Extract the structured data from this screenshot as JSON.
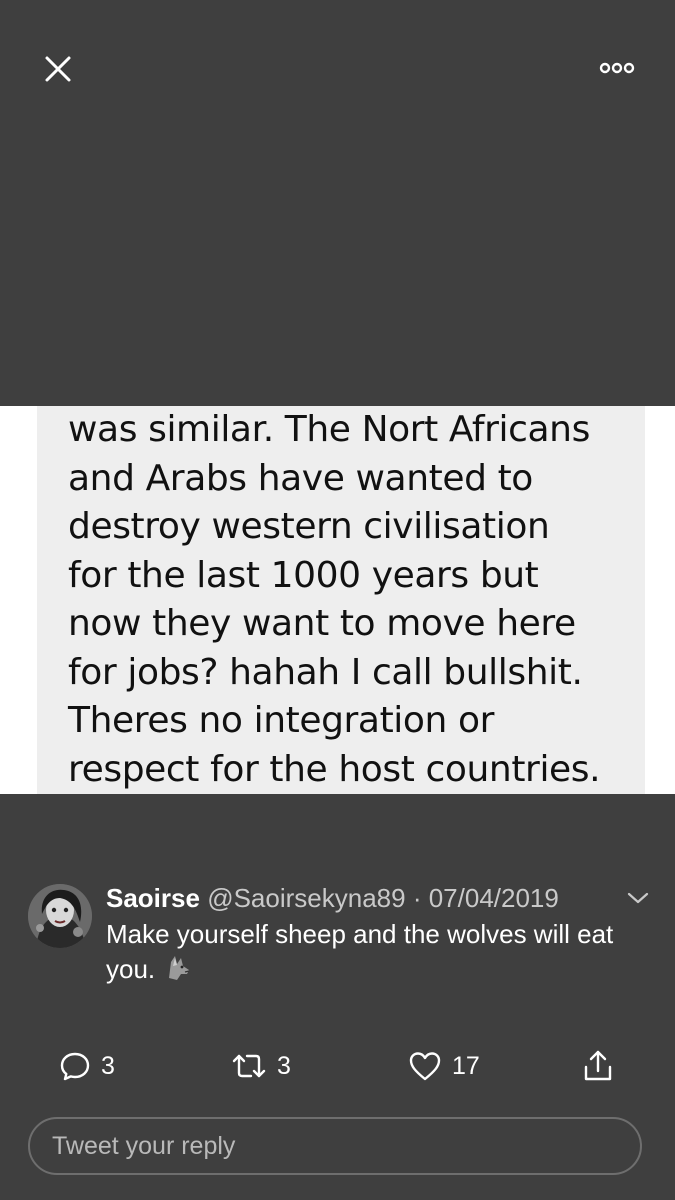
{
  "top_bar": {
    "close_icon": "close-icon",
    "more_icon": "more-horizontal-icon"
  },
  "media": {
    "lines": [
      "was similar. The Nort Africans",
      "and Arabs have wanted to",
      "destroy western civilisation",
      "for the last 1000 years but",
      "now they want to move here",
      "for jobs? hahah I call bullshit.",
      "Theres no integration or",
      "respect for the host countries."
    ]
  },
  "tweet": {
    "name": "Saoirse",
    "handle": "@Saoirsekyna89",
    "separator": "·",
    "date": "07/04/2019",
    "text": "Make yourself sheep and the wolves will eat you.",
    "emoji": "wolf-emoji"
  },
  "actions": {
    "replies": "3",
    "retweets": "3",
    "likes": "17"
  },
  "reply_input": {
    "placeholder": "Tweet your reply"
  },
  "colors": {
    "background": "#3f3f3f",
    "media_panel": "#eeeeee",
    "secondary_text": "#c9c9c9",
    "input_border": "#6e6e6e"
  }
}
